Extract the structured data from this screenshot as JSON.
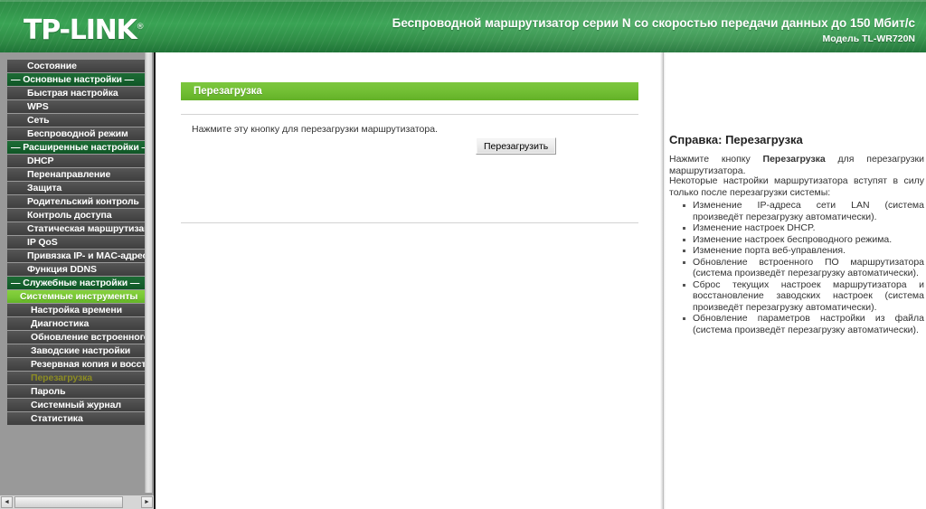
{
  "header": {
    "logo": "TP-LINK",
    "logo_mark": "®",
    "title": "Беспроводной маршрутизатор серии N со скоростью передачи данных до 150 Мбит/с",
    "model": "Модель TL-WR720N",
    "brand_green": "#3aa455"
  },
  "sidebar": {
    "items": [
      {
        "label": "Состояние",
        "type": "top"
      },
      {
        "label": "— Основные настройки —",
        "type": "cat"
      },
      {
        "label": "Быстрая настройка",
        "type": "item"
      },
      {
        "label": "WPS",
        "type": "item"
      },
      {
        "label": "Сеть",
        "type": "item"
      },
      {
        "label": "Беспроводной режим",
        "type": "item"
      },
      {
        "label": "— Расширенные настройки —",
        "type": "cat"
      },
      {
        "label": "DHCP",
        "type": "item"
      },
      {
        "label": "Перенаправление",
        "type": "item"
      },
      {
        "label": "Защита",
        "type": "item"
      },
      {
        "label": "Родительский контроль",
        "type": "item"
      },
      {
        "label": "Контроль доступа",
        "type": "item"
      },
      {
        "label": "Статическая маршрутизация",
        "type": "item"
      },
      {
        "label": "IP QoS",
        "type": "item"
      },
      {
        "label": "Привязка IP- и MAC-адресов",
        "type": "item"
      },
      {
        "label": "Функция DDNS",
        "type": "item"
      },
      {
        "label": "— Служебные настройки —",
        "type": "cat"
      },
      {
        "label": "Системные инструменты",
        "type": "parent-active"
      },
      {
        "label": "Настройка времени",
        "type": "lvl2"
      },
      {
        "label": "Диагностика",
        "type": "lvl2"
      },
      {
        "label": "Обновление встроенного ПО",
        "type": "lvl2"
      },
      {
        "label": "Заводские настройки",
        "type": "lvl2"
      },
      {
        "label": "Резервная копия и восстановление",
        "type": "lvl2"
      },
      {
        "label": "Перезагрузка",
        "type": "active"
      },
      {
        "label": "Пароль",
        "type": "lvl2"
      },
      {
        "label": "Системный журнал",
        "type": "lvl2"
      },
      {
        "label": "Статистика",
        "type": "lvl2"
      }
    ],
    "scrollbar": {
      "left_arrow": "◄",
      "right_arrow": "►"
    },
    "active_color": "#8c8c23",
    "parent_active_color": "#78c734"
  },
  "main": {
    "section_title": "Перезагрузка",
    "instruction": "Нажмите эту кнопку для перезагрузки маршрутизатора.",
    "reboot_button": "Перезагрузить"
  },
  "help": {
    "title": "Справка: Перезагрузка",
    "intro_before": "Нажмите кнопку ",
    "intro_bold": "Перезагрузка",
    "intro_after": " для перезагрузки маршрутизатора.",
    "paragraph": "Некоторые настройки маршрутизатора вступят в силу только после перезагрузки системы:",
    "items": [
      "Изменение IP-адреса сети LAN (система произведёт перезагрузку автоматически).",
      "Изменение настроек DHCP.",
      "Изменение настроек беспроводного режима.",
      "Изменение порта веб-управления.",
      "Обновление встроенного ПО маршрутизатора (система произведёт перезагрузку автоматически).",
      "Сброс текущих настроек маршрутизатора и восстановление заводских настроек (система произведёт перезагрузку автоматически).",
      "Обновление параметров настройки из файла (система произведёт перезагрузку автоматически)."
    ]
  }
}
